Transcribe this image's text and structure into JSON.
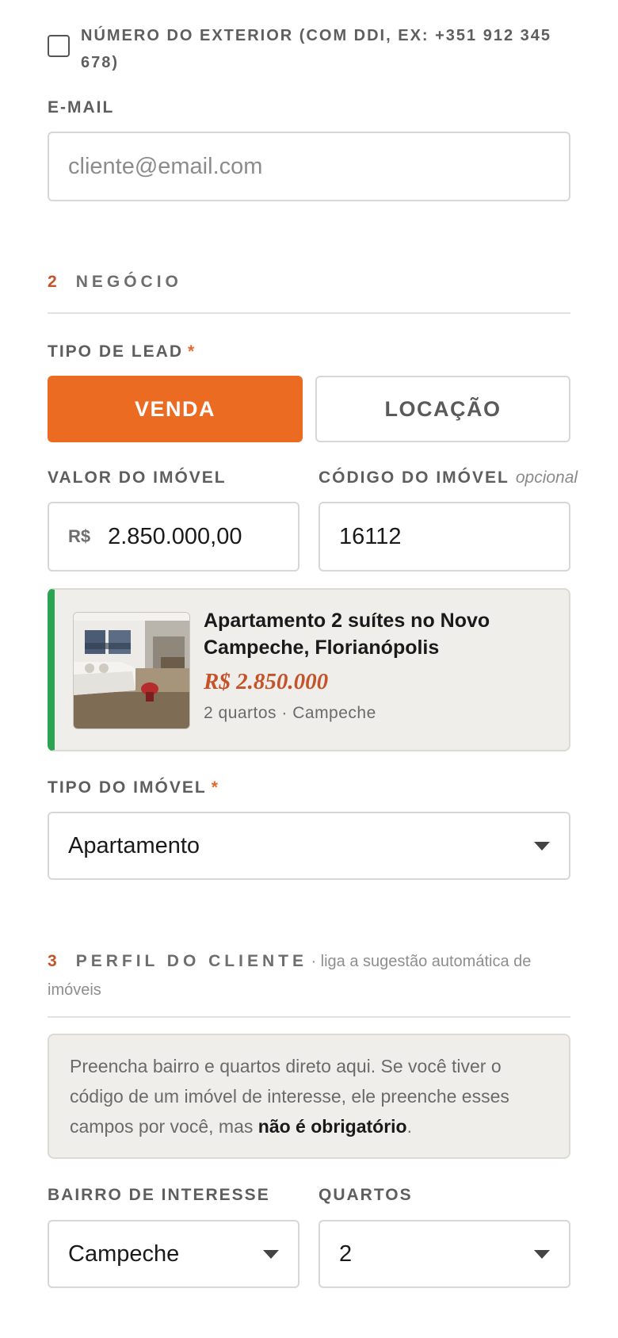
{
  "contact": {
    "foreign_number_label": "NÚMERO DO EXTERIOR (COM DDI, EX: +351 912 345 678)",
    "email_label": "E-MAIL",
    "email_placeholder": "cliente@email.com"
  },
  "section2": {
    "number": "2",
    "title": "NEGÓCIO",
    "lead_type_label": "TIPO DE LEAD",
    "required_mark": "*",
    "lead_options": [
      {
        "label": "VENDA",
        "selected": true
      },
      {
        "label": "LOCAÇÃO",
        "selected": false
      }
    ],
    "value_label": "VALOR DO IMÓVEL",
    "currency_prefix": "R$",
    "value": "2.850.000,00",
    "code_label": "CÓDIGO DO IMÓVEL",
    "code_optional": "opcional",
    "code_value": "16112",
    "property_card": {
      "title": "Apartamento 2 suítes no Novo Campeche, Florianópolis",
      "price": "R$ 2.850.000",
      "details": "2 quartos · Campeche"
    },
    "property_type_label": "TIPO DO IMÓVEL",
    "property_type_value": "Apartamento"
  },
  "section3": {
    "number": "3",
    "title": "PERFIL DO CLIENTE",
    "note": "· liga a sugestão automática de imóveis",
    "info_text_before": "Preencha bairro e quartos direto aqui. Se você tiver o código de um imóvel de interesse, ele preenche esses campos por você, mas ",
    "info_text_bold": "não é obrigatório",
    "info_text_after": ".",
    "neighborhood_label": "BAIRRO DE INTERESSE",
    "neighborhood_value": "Campeche",
    "bedrooms_label": "QUARTOS",
    "bedrooms_value": "2"
  },
  "colors": {
    "accent": "#ec6b22",
    "section_number": "#c4532a",
    "card_stripe": "#2aa352",
    "card_bg": "#efeeea",
    "price": "#c4532a"
  }
}
